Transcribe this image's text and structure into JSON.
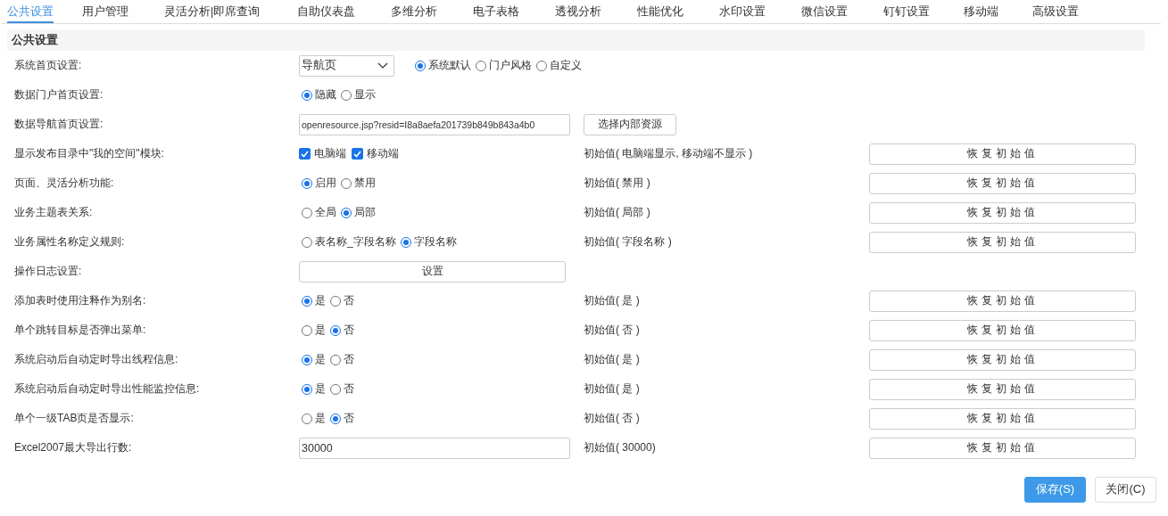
{
  "tabs": [
    {
      "label": "公共设置",
      "selected": true
    },
    {
      "label": "用户管理",
      "selected": false
    },
    {
      "label": "灵活分析|即席查询",
      "selected": false
    },
    {
      "label": "自助仪表盘",
      "selected": false
    },
    {
      "label": "多维分析",
      "selected": false
    },
    {
      "label": "电子表格",
      "selected": false
    },
    {
      "label": "透视分析",
      "selected": false
    },
    {
      "label": "性能优化",
      "selected": false
    },
    {
      "label": "水印设置",
      "selected": false
    },
    {
      "label": "微信设置",
      "selected": false
    },
    {
      "label": "钉钉设置",
      "selected": false
    },
    {
      "label": "移动端",
      "selected": false
    },
    {
      "label": "高级设置",
      "selected": false
    }
  ],
  "section": {
    "title": "公共设置"
  },
  "rows": [
    {
      "label": "系统首页设置:",
      "kind": "select_radio",
      "select": {
        "value": "导航页"
      },
      "options": [
        {
          "label": "系统默认",
          "selected": true
        },
        {
          "label": "门户风格",
          "selected": false
        },
        {
          "label": "自定义",
          "selected": false
        }
      ]
    },
    {
      "label": "数据门户首页设置:",
      "kind": "radio",
      "options": [
        {
          "label": "隐藏",
          "selected": true
        },
        {
          "label": "显示",
          "selected": false
        }
      ]
    },
    {
      "label": "数据导航首页设置:",
      "kind": "input_button",
      "value": "openresource.jsp?resid=I8a8aefa201739b849b843a4b0",
      "button": "选择内部资源"
    },
    {
      "label": "显示发布目录中\"我的空间\"模块:",
      "kind": "checkbox",
      "options": [
        {
          "label": "电脑端",
          "checked": true
        },
        {
          "label": "移动端",
          "checked": true
        }
      ],
      "initial": "初始值( 电脑端显示, 移动端不显示 )",
      "restore": "恢复初始值"
    },
    {
      "label": "页面、灵活分析功能:",
      "kind": "radio",
      "options": [
        {
          "label": "启用",
          "selected": true
        },
        {
          "label": "禁用",
          "selected": false
        }
      ],
      "initial": "初始值( 禁用 )",
      "restore": "恢复初始值"
    },
    {
      "label": "业务主题表关系:",
      "kind": "radio",
      "options": [
        {
          "label": "全局",
          "selected": false
        },
        {
          "label": "局部",
          "selected": true
        }
      ],
      "initial": "初始值( 局部 )",
      "restore": "恢复初始值"
    },
    {
      "label": "业务属性名称定义规则:",
      "kind": "radio",
      "options": [
        {
          "label": "表名称_字段名称",
          "selected": false
        },
        {
          "label": "字段名称",
          "selected": true
        }
      ],
      "initial": "初始值( 字段名称 )",
      "restore": "恢复初始值"
    },
    {
      "label": "操作日志设置:",
      "kind": "button",
      "button": "设置"
    },
    {
      "label": "添加表时使用注释作为别名:",
      "kind": "radio",
      "options": [
        {
          "label": "是",
          "selected": true
        },
        {
          "label": "否",
          "selected": false
        }
      ],
      "initial": "初始值( 是 )",
      "restore": "恢复初始值"
    },
    {
      "label": "单个跳转目标是否弹出菜单:",
      "kind": "radio",
      "options": [
        {
          "label": "是",
          "selected": false
        },
        {
          "label": "否",
          "selected": true
        }
      ],
      "initial": "初始值( 否 )",
      "restore": "恢复初始值"
    },
    {
      "label": "系统启动后自动定时导出线程信息:",
      "kind": "radio",
      "options": [
        {
          "label": "是",
          "selected": true
        },
        {
          "label": "否",
          "selected": false
        }
      ],
      "initial": "初始值( 是 )",
      "restore": "恢复初始值"
    },
    {
      "label": "系统启动后自动定时导出性能监控信息:",
      "kind": "radio",
      "options": [
        {
          "label": "是",
          "selected": true
        },
        {
          "label": "否",
          "selected": false
        }
      ],
      "initial": "初始值( 是 )",
      "restore": "恢复初始值"
    },
    {
      "label": "单个一级TAB页是否显示:",
      "kind": "radio",
      "options": [
        {
          "label": "是",
          "selected": false
        },
        {
          "label": "否",
          "selected": true
        }
      ],
      "initial": "初始值( 否 )",
      "restore": "恢复初始值"
    },
    {
      "label": "Excel2007最大导出行数:",
      "kind": "input",
      "value": "30000",
      "initial": "初始值( 30000)",
      "restore": "恢复初始值"
    }
  ],
  "footer": {
    "buttons": [
      {
        "label": "保存(S)",
        "kind": "primary"
      },
      {
        "label": "关闭(C)",
        "kind": "default"
      }
    ]
  }
}
